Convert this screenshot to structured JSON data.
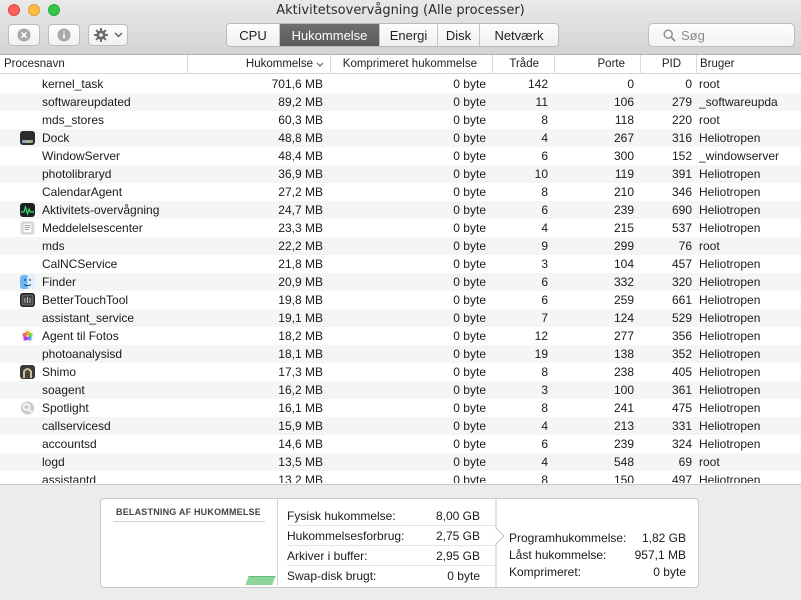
{
  "window": {
    "title": "Aktivitetsovervågning (Alle processer)"
  },
  "toolbar": {
    "tabs": [
      "CPU",
      "Hukommelse",
      "Energi",
      "Disk",
      "Netværk"
    ],
    "active_tab": "Hukommelse",
    "search_placeholder": "Søg"
  },
  "table": {
    "columns": [
      "Procesnavn",
      "Hukommelse",
      "Komprimeret hukommelse",
      "Tråde",
      "Porte",
      "PID",
      "Bruger"
    ],
    "sorted_column": "Hukommelse",
    "rows": [
      {
        "name": "kernel_task",
        "mem": "701,6 MB",
        "comp": "0 byte",
        "threads": "142",
        "ports": "0",
        "pid": "0",
        "user": "root",
        "icon": ""
      },
      {
        "name": "softwareupdated",
        "mem": "89,2 MB",
        "comp": "0 byte",
        "threads": "11",
        "ports": "106",
        "pid": "279",
        "user": "_softwareupda",
        "icon": ""
      },
      {
        "name": "mds_stores",
        "mem": "60,3 MB",
        "comp": "0 byte",
        "threads": "8",
        "ports": "118",
        "pid": "220",
        "user": "root",
        "icon": ""
      },
      {
        "name": "Dock",
        "mem": "48,8 MB",
        "comp": "0 byte",
        "threads": "4",
        "ports": "267",
        "pid": "316",
        "user": "Heliotropen",
        "icon": "dock-icon"
      },
      {
        "name": "WindowServer",
        "mem": "48,4 MB",
        "comp": "0 byte",
        "threads": "6",
        "ports": "300",
        "pid": "152",
        "user": "_windowserver",
        "icon": ""
      },
      {
        "name": "photolibraryd",
        "mem": "36,9 MB",
        "comp": "0 byte",
        "threads": "10",
        "ports": "119",
        "pid": "391",
        "user": "Heliotropen",
        "icon": ""
      },
      {
        "name": "CalendarAgent",
        "mem": "27,2 MB",
        "comp": "0 byte",
        "threads": "8",
        "ports": "210",
        "pid": "346",
        "user": "Heliotropen",
        "icon": ""
      },
      {
        "name": "Aktivitets-overvågning",
        "mem": "24,7 MB",
        "comp": "0 byte",
        "threads": "6",
        "ports": "239",
        "pid": "690",
        "user": "Heliotropen",
        "icon": "activity-monitor-icon"
      },
      {
        "name": "Meddelelsescenter",
        "mem": "23,3 MB",
        "comp": "0 byte",
        "threads": "4",
        "ports": "215",
        "pid": "537",
        "user": "Heliotropen",
        "icon": "notification-center-icon"
      },
      {
        "name": "mds",
        "mem": "22,2 MB",
        "comp": "0 byte",
        "threads": "9",
        "ports": "299",
        "pid": "76",
        "user": "root",
        "icon": ""
      },
      {
        "name": "CalNCService",
        "mem": "21,8 MB",
        "comp": "0 byte",
        "threads": "3",
        "ports": "104",
        "pid": "457",
        "user": "Heliotropen",
        "icon": ""
      },
      {
        "name": "Finder",
        "mem": "20,9 MB",
        "comp": "0 byte",
        "threads": "6",
        "ports": "332",
        "pid": "320",
        "user": "Heliotropen",
        "icon": "finder-icon"
      },
      {
        "name": "BetterTouchTool",
        "mem": "19,8 MB",
        "comp": "0 byte",
        "threads": "6",
        "ports": "259",
        "pid": "661",
        "user": "Heliotropen",
        "icon": "bettertouchtool-icon"
      },
      {
        "name": "assistant_service",
        "mem": "19,1 MB",
        "comp": "0 byte",
        "threads": "7",
        "ports": "124",
        "pid": "529",
        "user": "Heliotropen",
        "icon": ""
      },
      {
        "name": "Agent til Fotos",
        "mem": "18,2 MB",
        "comp": "0 byte",
        "threads": "12",
        "ports": "277",
        "pid": "356",
        "user": "Heliotropen",
        "icon": "photos-icon"
      },
      {
        "name": "photoanalysisd",
        "mem": "18,1 MB",
        "comp": "0 byte",
        "threads": "19",
        "ports": "138",
        "pid": "352",
        "user": "Heliotropen",
        "icon": ""
      },
      {
        "name": "Shimo",
        "mem": "17,3 MB",
        "comp": "0 byte",
        "threads": "8",
        "ports": "238",
        "pid": "405",
        "user": "Heliotropen",
        "icon": "shimo-icon"
      },
      {
        "name": "soagent",
        "mem": "16,2 MB",
        "comp": "0 byte",
        "threads": "3",
        "ports": "100",
        "pid": "361",
        "user": "Heliotropen",
        "icon": ""
      },
      {
        "name": "Spotlight",
        "mem": "16,1 MB",
        "comp": "0 byte",
        "threads": "8",
        "ports": "241",
        "pid": "475",
        "user": "Heliotropen",
        "icon": "spotlight-icon"
      },
      {
        "name": "callservicesd",
        "mem": "15,9 MB",
        "comp": "0 byte",
        "threads": "4",
        "ports": "213",
        "pid": "331",
        "user": "Heliotropen",
        "icon": ""
      },
      {
        "name": "accountsd",
        "mem": "14,6 MB",
        "comp": "0 byte",
        "threads": "6",
        "ports": "239",
        "pid": "324",
        "user": "Heliotropen",
        "icon": ""
      },
      {
        "name": "logd",
        "mem": "13,5 MB",
        "comp": "0 byte",
        "threads": "4",
        "ports": "548",
        "pid": "69",
        "user": "root",
        "icon": ""
      },
      {
        "name": "assistantd",
        "mem": "13,2 MB",
        "comp": "0 byte",
        "threads": "8",
        "ports": "150",
        "pid": "497",
        "user": "Heliotropen",
        "icon": ""
      }
    ]
  },
  "memory_panel": {
    "title": "BELASTNING AF HUKOMMELSE",
    "stats": [
      {
        "label": "Fysisk hukommelse:",
        "value": "8,00 GB"
      },
      {
        "label": "Hukommelsesforbrug:",
        "value": "2,75 GB"
      },
      {
        "label": "Arkiver i buffer:",
        "value": "2,95 GB"
      },
      {
        "label": "Swap-disk brugt:",
        "value": "0 byte"
      }
    ],
    "breakdown": [
      {
        "label": "Programhukommelse:",
        "value": "1,82 GB"
      },
      {
        "label": "Låst hukommelse:",
        "value": "957,1 MB"
      },
      {
        "label": "Komprimeret:",
        "value": "0 byte"
      }
    ],
    "pressure_color": "#8fd59b"
  }
}
